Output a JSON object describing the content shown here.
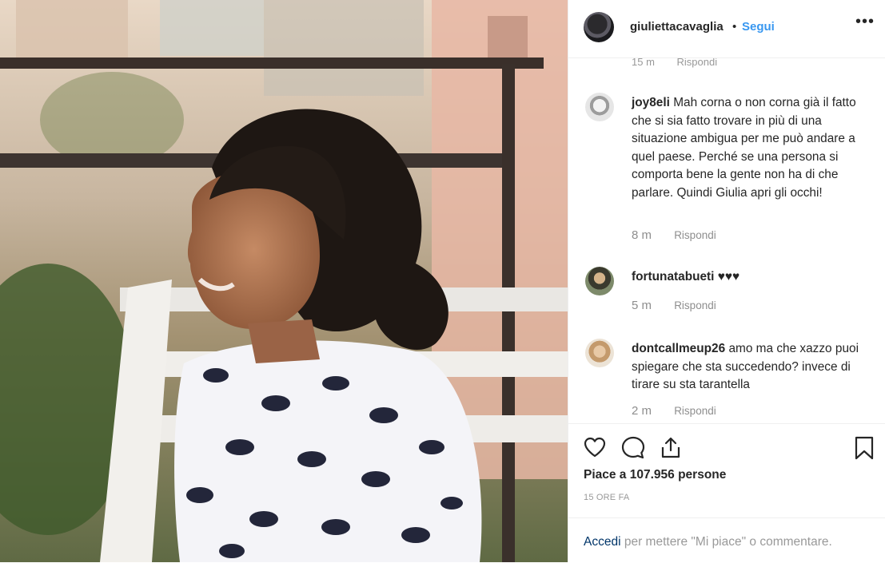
{
  "header": {
    "username": "giuliettacavaglia",
    "separator": "•",
    "follow_label": "Segui",
    "more_label": "•••"
  },
  "partial_meta": {
    "time": "15 m",
    "reply": "Rispondi"
  },
  "comments": [
    {
      "username": "joy8eli",
      "text": "Mah corna o non corna già il fatto che si sia fatto trovare in più di una situazione ambigua per me può andare a quel paese. Perché se una persona si comporta bene la gente non ha di che parlare. Quindi Giulia apri gli occhi!",
      "time": "8 m",
      "reply": "Rispondi"
    },
    {
      "username": "fortunatabueti",
      "text": "♥♥♥",
      "time": "5 m",
      "reply": "Rispondi"
    },
    {
      "username": "dontcallmeup26",
      "text": "amo ma che xazzo puoi spiegare che sta succedendo? invece di tirare su sta tarantella",
      "time": "2 m",
      "reply": "Rispondi"
    }
  ],
  "actions": {
    "like_icon": "heart-icon",
    "comment_icon": "comment-icon",
    "share_icon": "share-icon",
    "save_icon": "bookmark-icon"
  },
  "likes": "Piace a 107.956 persone",
  "posted": "15 ORE FA",
  "footer": {
    "login": "Accedi",
    "rest": " per mettere \"Mi piace\" o commentare."
  },
  "colors": {
    "accent": "#3897f0",
    "text": "#262626",
    "muted": "#8e8e8e",
    "border": "#efefef"
  }
}
